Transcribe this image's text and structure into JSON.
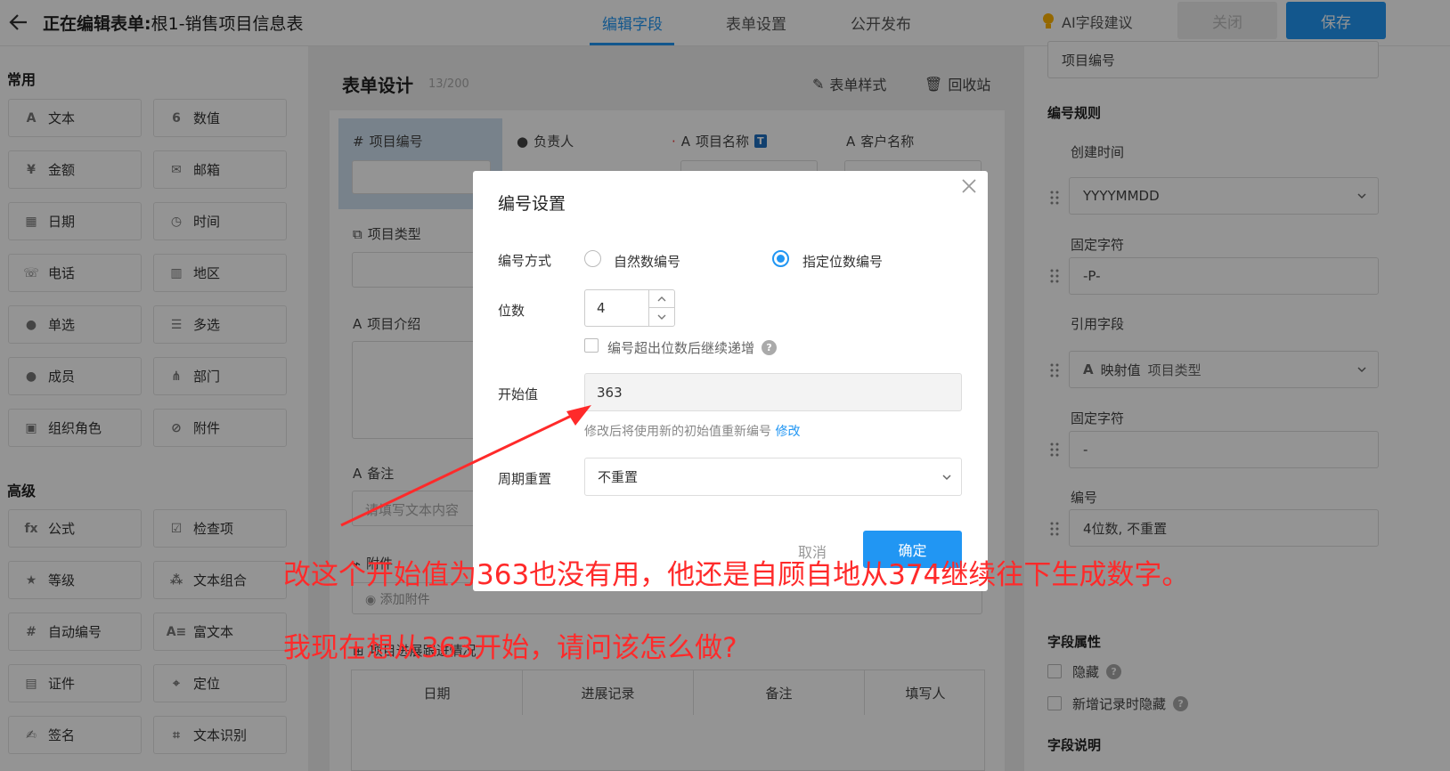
{
  "topbar": {
    "editing_prefix": "正在编辑表单:",
    "form_name": "根1-销售项目信息表",
    "tabs": [
      "编辑字段",
      "表单设置",
      "公开发布"
    ],
    "ai_suggest": "AI字段建议",
    "close_label": "关闭",
    "save_label": "保存"
  },
  "left": {
    "common_title": "常用",
    "common_fields": [
      "文本",
      "数值",
      "金额",
      "邮箱",
      "日期",
      "时间",
      "电话",
      "地区",
      "单选",
      "多选",
      "成员",
      "部门",
      "组织角色",
      "附件"
    ],
    "advanced_title": "高级",
    "advanced_fields": [
      "公式",
      "检查项",
      "等级",
      "文本组合",
      "自动编号",
      "富文本",
      "证件",
      "定位",
      "签名",
      "文本识别"
    ]
  },
  "center": {
    "title": "表单设计",
    "count": "13/200",
    "form_style": "表单样式",
    "recycle": "回收站",
    "fields": {
      "project_no": "项目编号",
      "owner": "负责人",
      "project_name": "项目名称",
      "customer": "客户名称",
      "project_type": "项目类型",
      "project_intro": "项目介绍",
      "remark": "备注",
      "remark_placeholder": "请填写文本内容",
      "attachment_label": "附件",
      "add_attachment": "添加附件",
      "progress_table": "项目进展跟进情况"
    },
    "table_headers": [
      "日期",
      "进展记录",
      "备注",
      "填写人"
    ]
  },
  "right": {
    "top_value": "项目编号",
    "rule_title": "编号规则",
    "created_time": "创建时间",
    "date_format": "YYYYMMDD",
    "fixed_char_1": "固定字符",
    "fixed_val_1": "-P-",
    "ref_field": "引用字段",
    "mapped_label": "映射值",
    "mapped_value": "项目类型",
    "fixed_char_2": "固定字符",
    "fixed_val_2": "-",
    "number_label": "编号",
    "number_value": "4位数, 不重置",
    "attr_title": "字段属性",
    "hidden": "隐藏",
    "hide_on_new": "新增记录时隐藏",
    "field_desc": "字段说明"
  },
  "modal": {
    "title": "编号设置",
    "method_label": "编号方式",
    "opt_natural": "自然数编号",
    "opt_fixed": "指定位数编号",
    "digits_label": "位数",
    "digits_value": "4",
    "overflow_label": "编号超出位数后继续递增",
    "start_label": "开始值",
    "start_value": "363",
    "hint": "修改后将使用新的初始值重新编号",
    "hint_link": "修改",
    "cycle_label": "周期重置",
    "cycle_value": "不重置",
    "cancel": "取消",
    "ok": "确定"
  },
  "annotations": {
    "line1": "改这个开始值为363也没有用，他还是自顾自地从374继续往下生成数字。",
    "line2": "我现在想从363开始，请问该怎么做?"
  },
  "colors": {
    "accent": "#2196f3",
    "annotation": "#ff2a2a"
  }
}
